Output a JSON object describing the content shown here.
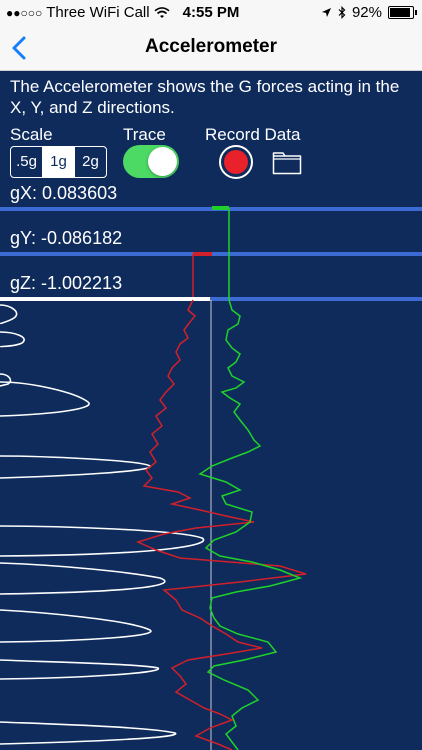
{
  "status": {
    "carrier": "Three WiFi Call",
    "signal": "●●○○○",
    "time": "4:55 PM",
    "battery": "92%"
  },
  "nav": {
    "title": "Accelerometer"
  },
  "description": "The Accelerometer shows the G forces acting in the X, Y, and Z directions.",
  "controls": {
    "scale_label": "Scale",
    "scale_options": [
      ".5g",
      "1g",
      "2g"
    ],
    "scale_selected": "1g",
    "trace_label": "Trace",
    "trace_on": true,
    "record_label": "Record Data"
  },
  "readings": {
    "gx": "gX:  0.083603",
    "gy": "gY: -0.086182",
    "gz": "gZ: -1.002213"
  },
  "colors": {
    "background": "#0e2b5c",
    "x_trace": "#1fd22a",
    "y_trace": "#d2202a",
    "z_trace": "#ffffff",
    "separator": "#3c6bd4",
    "toggle_on": "#4cd964"
  }
}
